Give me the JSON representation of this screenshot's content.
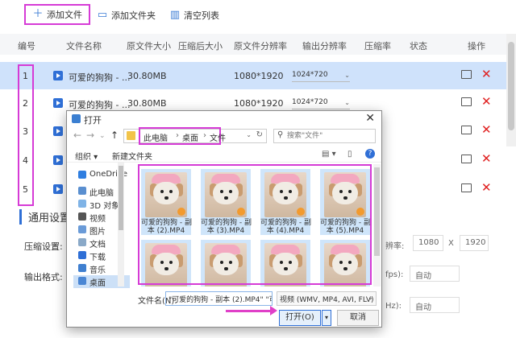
{
  "toolbar": {
    "add_file": "添加文件",
    "add_folder": "添加文件夹",
    "clear_list": "清空列表"
  },
  "table": {
    "headers": [
      "编号",
      "文件名称",
      "原文件大小",
      "压缩后大小",
      "原文件分辨率",
      "输出分辨率",
      "压缩率",
      "状态",
      "操作"
    ],
    "rows": [
      {
        "idx": "1",
        "name": "可爱的狗狗 - ...",
        "size": "30.80MB",
        "res": "1080*1920",
        "out": "1024*720"
      },
      {
        "idx": "2",
        "name": "可爱的狗狗 - ...",
        "size": "30.80MB",
        "res": "1080*1920",
        "out": "1024*720"
      },
      {
        "idx": "3",
        "name": "",
        "size": "",
        "res": "",
        "out": ""
      },
      {
        "idx": "4",
        "name": "",
        "size": "",
        "res": "",
        "out": ""
      },
      {
        "idx": "5",
        "name": "",
        "size": "",
        "res": "",
        "out": ""
      }
    ]
  },
  "settings": {
    "title": "通用设置",
    "compress_label": "压缩设置:",
    "format_label": "输出格式:",
    "rate_label": "辨率:",
    "width": "1080",
    "x": "X",
    "height": "1920",
    "fps_label": "fps):",
    "fps_value": "自动",
    "hz_label": "Hz):",
    "hz_value": "自动"
  },
  "dialog": {
    "title": "打开",
    "breadcrumb": [
      "此电脑",
      "桌面",
      "文件"
    ],
    "search_placeholder": "搜索\"文件\"",
    "organize": "组织 ▾",
    "new_folder": "新建文件夹",
    "nav": [
      "OneDrive",
      "此电脑",
      "3D 对象",
      "视频",
      "图片",
      "文档",
      "下载",
      "音乐",
      "桌面"
    ],
    "files": [
      {
        "line1": "可爱的狗狗 - 副",
        "line2": "本 (2).MP4"
      },
      {
        "line1": "可爱的狗狗 - 副",
        "line2": "本 (3).MP4"
      },
      {
        "line1": "可爱的狗狗 - 副",
        "line2": "本 (4).MP4"
      },
      {
        "line1": "可爱的狗狗 - 副",
        "line2": "本 (5).MP4"
      },
      {
        "line1": "",
        "line2": ""
      },
      {
        "line1": "",
        "line2": ""
      },
      {
        "line1": "",
        "line2": ""
      },
      {
        "line1": "",
        "line2": ""
      }
    ],
    "filename_label": "文件名(N):",
    "filename_value": "\"可爱的狗狗 - 副本 (2).MP4\" \"可",
    "filetype": "视频 (WMV, MP4, AVI, FLV)",
    "open": "打开(O)",
    "cancel": "取消"
  },
  "colors": {
    "accent": "#2f6fd6",
    "highlight": "#d63bd6",
    "selected_row": "#cfe2fb",
    "delete": "#e02020"
  }
}
